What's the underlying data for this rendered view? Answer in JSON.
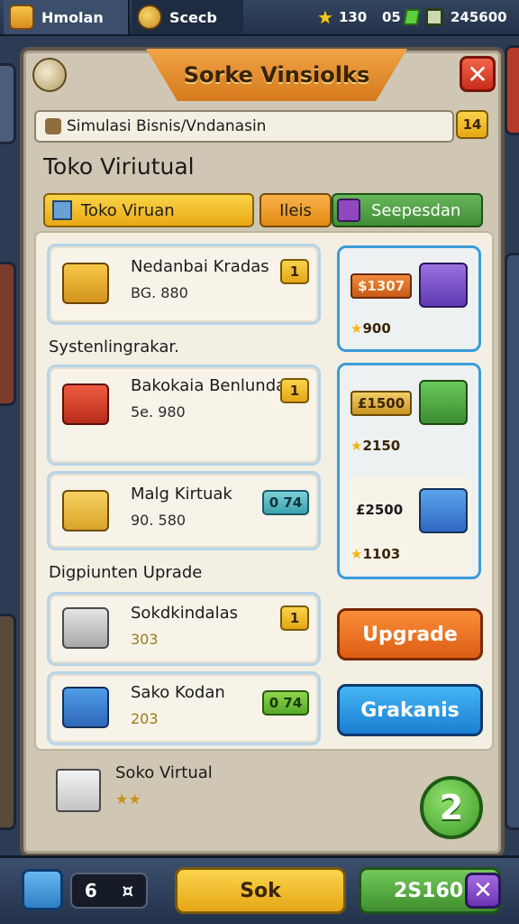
{
  "topbar": {
    "home_tab": "Hmolan",
    "search_tab": "Scecb",
    "stars": "130",
    "gems": "05",
    "coins": "245600"
  },
  "dialog": {
    "title": "Sorke Vinsiolks",
    "close_label": "✕",
    "search_value": "Simulasi Bisnis/Vndanasin",
    "badge": "14",
    "heading": "Toko Viriutual",
    "tabs": [
      {
        "label": "Toko Viruan"
      },
      {
        "label": "Ileis"
      },
      {
        "label": "Seepesdan"
      }
    ],
    "items": [
      {
        "name": "Nedanbai Kradas",
        "price": "BG. 880",
        "btn": "1"
      },
      {
        "name": "Bakokaia Benlunda",
        "price": "5e. 980",
        "btn": "1"
      },
      {
        "name": "Malg Kirtuak",
        "price": "90. 580",
        "btn": "0 74"
      },
      {
        "name": "Sokdkindalas",
        "price": "303",
        "btn": "1"
      },
      {
        "name": "Sako Kodan",
        "price": "203",
        "btn": "0 74"
      }
    ],
    "section_labels": {
      "system": "Systenlingrakar.",
      "upgrade": "Digpiunten Uprade"
    },
    "side_items": [
      {
        "price": "$1307",
        "stars": "900"
      },
      {
        "price": "£1500",
        "stars": "2150"
      },
      {
        "price": "£2500",
        "stars": "1103"
      }
    ],
    "upgrade_label": "Upgrade",
    "info_label": "Grakanis",
    "footer": {
      "name": "Soko Virtual",
      "stars": "★★"
    },
    "fab_label": "2"
  },
  "bottombar": {
    "count_left": "6",
    "count_right": "¤",
    "mid_label": "Sok",
    "right_value": "2S160",
    "close_label": "✕"
  }
}
